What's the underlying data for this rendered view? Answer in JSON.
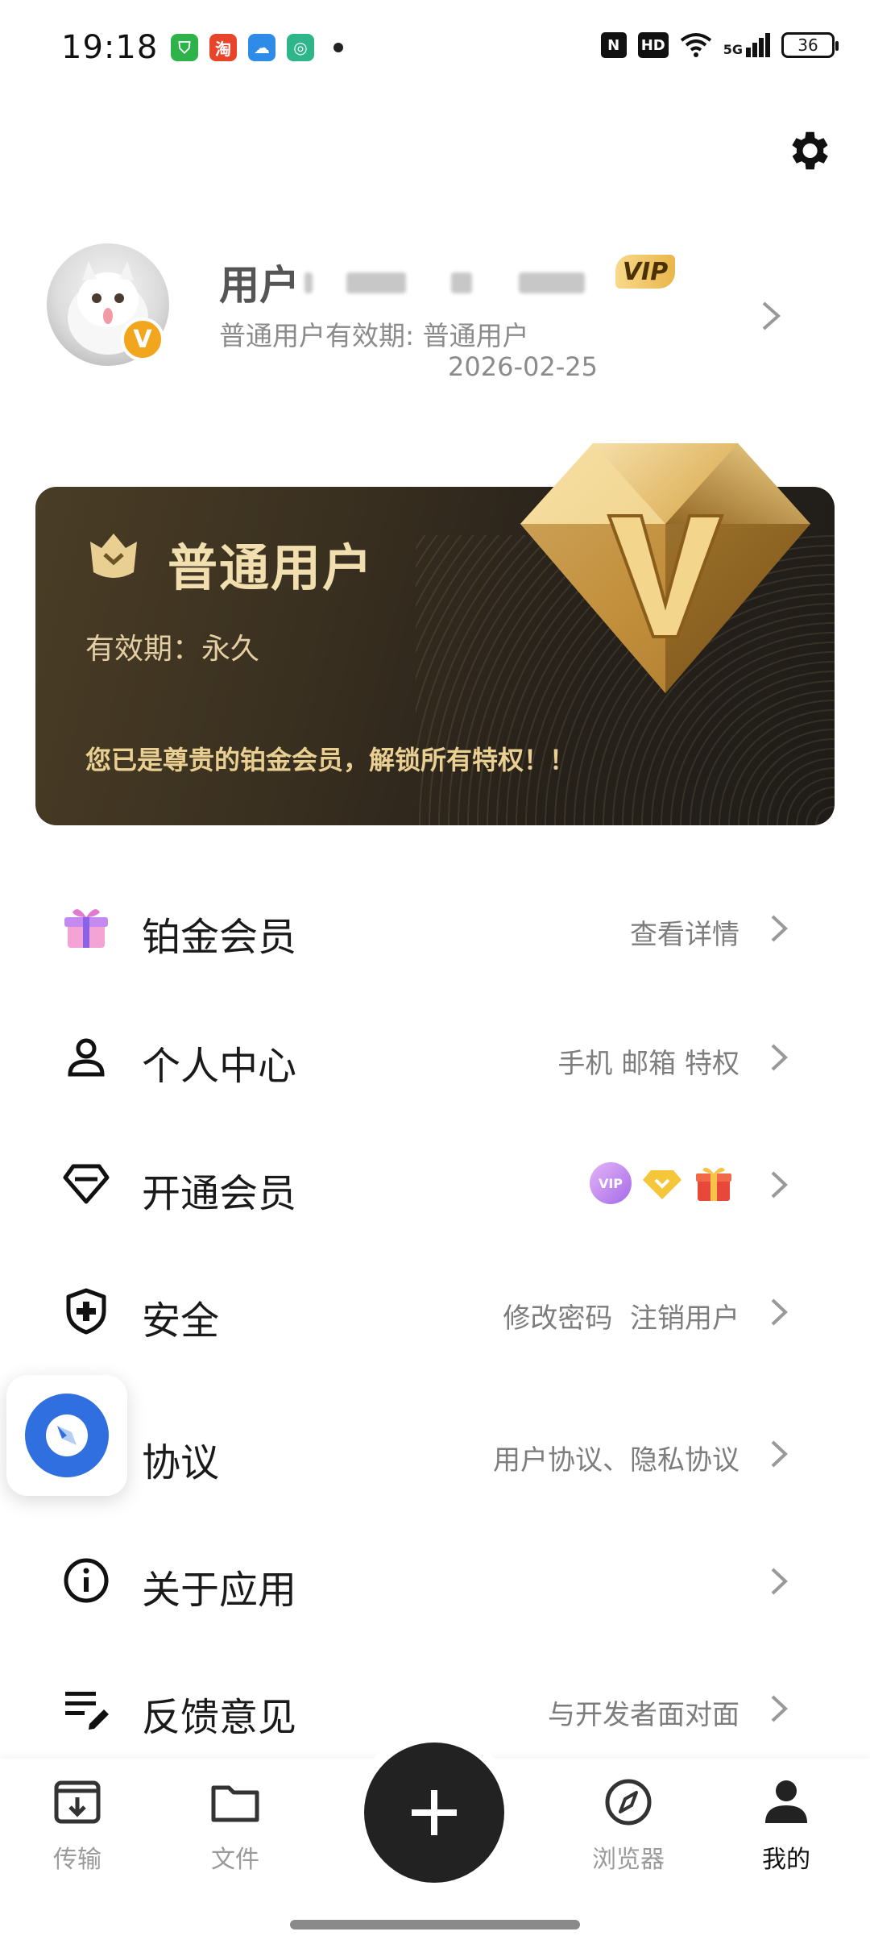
{
  "status_bar": {
    "time": "19:18",
    "notifications": [
      {
        "icon": "shield-app-icon",
        "color": "#2db34a",
        "glyph": "⛉"
      },
      {
        "icon": "taobao-app-icon",
        "color": "#e8442a",
        "glyph": "淘"
      },
      {
        "icon": "cloud-app-icon",
        "color": "#2f8be8",
        "glyph": "☁"
      },
      {
        "icon": "spiral-app-icon",
        "color": "#2fb58a",
        "glyph": "◎"
      }
    ],
    "nfc_label": "N",
    "hd_label": "HD",
    "network_label": "5G",
    "battery": "36"
  },
  "profile": {
    "name_prefix": "用户",
    "vip_tag": "VIP",
    "avatar_badge": "V",
    "subtitle": "普通用户有效期: 普通用户",
    "expiry": "2026-02-25"
  },
  "member_card": {
    "title": "普通用户",
    "validity": "有效期：永久",
    "message": "您已是尊贵的铂金会员，解锁所有特权！！",
    "gem_letter": "V"
  },
  "menu": {
    "items": [
      {
        "label": "铂金会员",
        "hint": "查看详情",
        "icon": "gift-box-icon"
      },
      {
        "label": "个人中心",
        "hint": "手机 邮箱 特权",
        "icon": "person-icon"
      },
      {
        "label": "开通会员",
        "hint": "",
        "icon": "diamond-icon"
      },
      {
        "label": "安全",
        "hint": "修改密码  注销用户",
        "icon": "shield-plus-icon"
      },
      {
        "label": "协议",
        "hint": "用户协议、隐私协议",
        "icon": "document-icon"
      },
      {
        "label": "关于应用",
        "hint": "",
        "icon": "info-icon"
      },
      {
        "label": "反馈意见",
        "hint": "与开发者面对面",
        "icon": "edit-list-icon"
      }
    ],
    "vip_badge_text": "VIP"
  },
  "bottom_nav": {
    "items": [
      {
        "label": "传输",
        "icon": "download-box-icon"
      },
      {
        "label": "文件",
        "icon": "folder-icon"
      },
      {
        "label": "浏览器",
        "icon": "compass-icon"
      },
      {
        "label": "我的",
        "icon": "user-icon"
      }
    ],
    "active": "我的"
  },
  "colors": {
    "card_gold_text": "#f2dfb0",
    "accent_orange": "#f2a61e",
    "fab_dark": "#222222",
    "assistant_blue": "#2f6fe0"
  }
}
